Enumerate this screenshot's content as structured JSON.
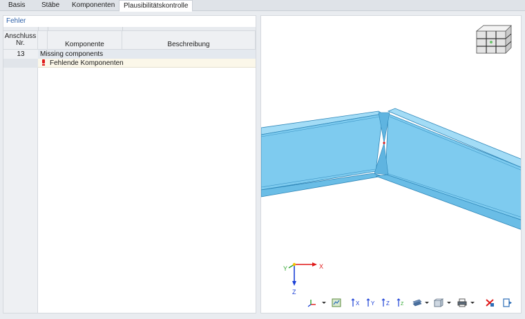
{
  "tabs": [
    {
      "label": "Basis",
      "active": false
    },
    {
      "label": "Stäbe",
      "active": false
    },
    {
      "label": "Komponenten",
      "active": false
    },
    {
      "label": "Plausibilitätskontrolle",
      "active": true
    }
  ],
  "left_panel": {
    "title": "Fehler",
    "columns": {
      "connection": "Anschluss\nNr.",
      "component": "Komponente",
      "description": "Beschreibung"
    },
    "rows": [
      {
        "nr": "13",
        "group_label": "Missing components"
      },
      {
        "item_label": "Fehlende Komponenten",
        "icon": "error-icon"
      }
    ]
  },
  "viewport": {
    "axes": {
      "x": "X",
      "y": "Y",
      "z": "Z"
    },
    "nav_cube_icon": "view-cube-icon",
    "colors": {
      "member_fill": "#7ecbef",
      "member_edge": "#2d86b8",
      "background": "#ffffff"
    }
  },
  "toolbar": {
    "buttons": [
      "axis-system-icon",
      "select-icon",
      "view-x-icon",
      "view-y-icon",
      "view-z-icon",
      "view-iso-icon",
      "display-mode-icon",
      "box-view-icon",
      "print-icon",
      "delete-icon",
      "exit-icon"
    ]
  }
}
